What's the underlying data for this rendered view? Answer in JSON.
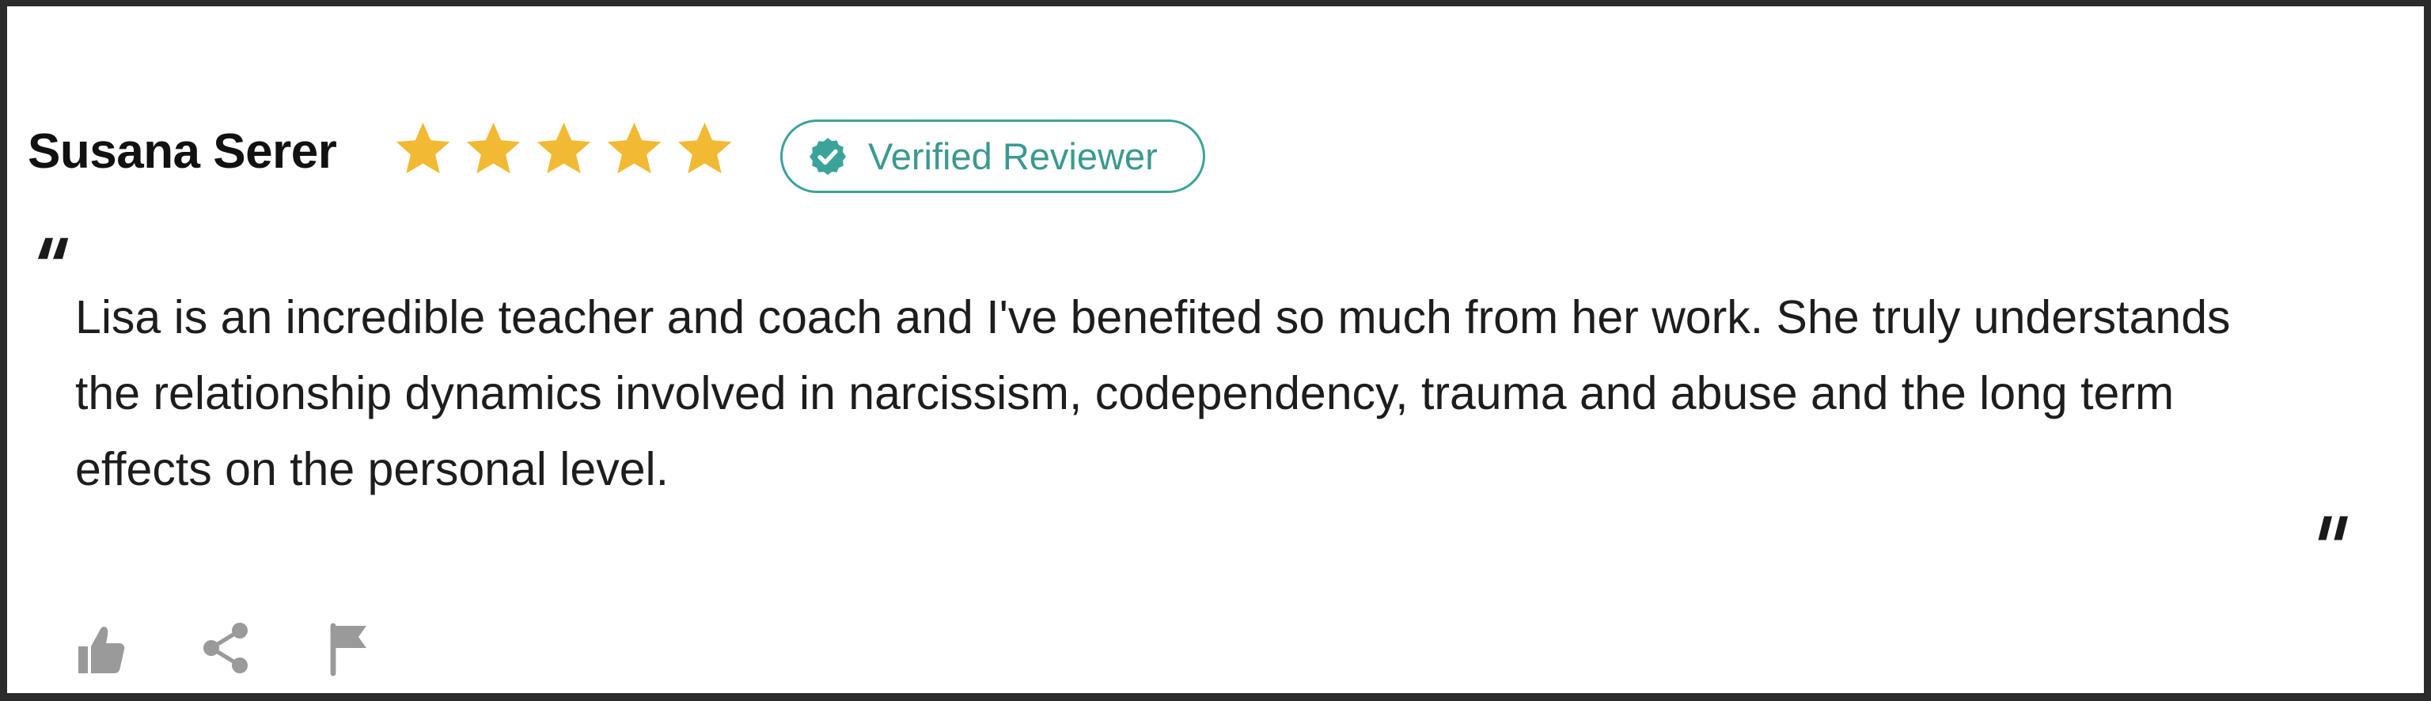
{
  "review": {
    "reviewer_name": "Susana Serer",
    "rating": 5,
    "rating_max": 5,
    "badge_label": "Verified Reviewer",
    "text": "Lisa is an incredible teacher and coach and I've benefited so much from her work. She truly understands the relationship dynamics involved in narcissism, codependency, trauma and abuse and the long term effects on the personal level."
  },
  "icons": {
    "star": "star-icon",
    "badge": "verified-check-icon",
    "open_quote": "open-quote-icon",
    "close_quote": "close-quote-icon",
    "like": "thumbs-up-icon",
    "share": "share-icon",
    "report": "flag-icon"
  },
  "colors": {
    "star": "#f2b933",
    "badge_accent": "#3aa39a",
    "text": "#1d1d1d",
    "action_icon": "#9a9a9a",
    "frame_border": "#2b2b2b"
  }
}
